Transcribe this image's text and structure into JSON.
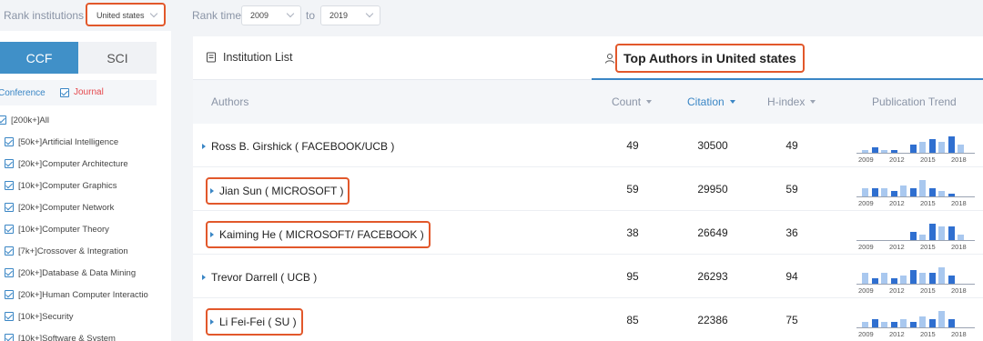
{
  "filters": {
    "rank_institutions_label": "Rank institutions in",
    "country_value": "United states",
    "rank_time_label": "Rank time",
    "from_year": "2009",
    "to_label": "to",
    "to_year": "2019"
  },
  "sidebar": {
    "tabs": [
      "CCF",
      "SCI"
    ],
    "active_tab": "CCF",
    "type_conference": "Conference",
    "type_journal": "Journal",
    "categories": [
      {
        "label": "[200k+]All",
        "expandable": false
      },
      {
        "label": "[50k+]Artificial Intelligence",
        "expandable": true
      },
      {
        "label": "[20k+]Computer Architecture",
        "expandable": true
      },
      {
        "label": "[10k+]Computer Graphics",
        "expandable": true
      },
      {
        "label": "[20k+]Computer Network",
        "expandable": true
      },
      {
        "label": "[10k+]Computer Theory",
        "expandable": true
      },
      {
        "label": "[7k+]Crossover & Integration",
        "expandable": true
      },
      {
        "label": "[20k+]Database & Data Mining",
        "expandable": true
      },
      {
        "label": "[20k+]Human Computer Interactio",
        "expandable": true
      },
      {
        "label": "[10k+]Security",
        "expandable": true
      },
      {
        "label": "[10k+]Software & System",
        "expandable": true
      }
    ]
  },
  "tabs": {
    "institution_list": "Institution List",
    "top_authors": "Top Authors in United states"
  },
  "table": {
    "columns": {
      "authors": "Authors",
      "count": "Count",
      "citation": "Citation",
      "hindex": "H-index",
      "trend": "Publication Trend"
    },
    "trend_years": [
      "2009",
      "2012",
      "2015",
      "2018"
    ],
    "rows": [
      {
        "name": "Ross B. Girshick ( FACEBOOK/UCB )",
        "count": "49",
        "citation": "30500",
        "hindex": "49",
        "highlighted": false,
        "trend": [
          1,
          2,
          1,
          1,
          0,
          3,
          4,
          5,
          4,
          6,
          3
        ]
      },
      {
        "name": "Jian Sun ( MICROSOFT )",
        "count": "59",
        "citation": "29950",
        "hindex": "59",
        "highlighted": true,
        "trend": [
          3,
          3,
          3,
          2,
          4,
          3,
          6,
          3,
          2,
          1,
          0
        ]
      },
      {
        "name": "Kaiming He ( MICROSOFT/ FACEBOOK )",
        "count": "38",
        "citation": "26649",
        "hindex": "36",
        "highlighted": true,
        "trend": [
          0,
          0,
          0,
          0,
          0,
          3,
          2,
          6,
          5,
          5,
          2
        ]
      },
      {
        "name": "Trevor Darrell ( UCB )",
        "count": "95",
        "citation": "26293",
        "hindex": "94",
        "highlighted": false,
        "trend": [
          4,
          2,
          4,
          2,
          3,
          5,
          4,
          4,
          6,
          3,
          0
        ]
      },
      {
        "name": "Li Fei-Fei ( SU )",
        "count": "85",
        "citation": "22386",
        "hindex": "75",
        "highlighted": true,
        "trend": [
          2,
          3,
          2,
          2,
          3,
          2,
          4,
          3,
          6,
          3,
          0
        ]
      }
    ]
  },
  "colors": {
    "accent": "#3a86c5",
    "highlight_box": "#e2582b",
    "bar_dark": "#2f6fd0",
    "bar_light": "#a9c8ef"
  }
}
